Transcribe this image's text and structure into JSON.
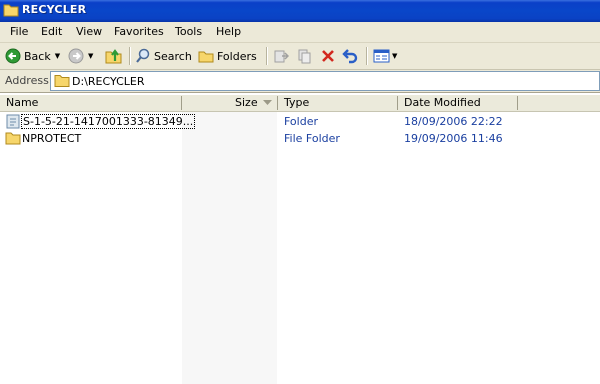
{
  "window": {
    "title": "RECYCLER"
  },
  "menu": [
    "File",
    "Edit",
    "View",
    "Favorites",
    "Tools",
    "Help"
  ],
  "toolbar": {
    "back_label": "Back",
    "search_label": "Search",
    "folders_label": "Folders"
  },
  "address": {
    "label": "Address",
    "value": "D:\\RECYCLER"
  },
  "columns": {
    "name": "Name",
    "size": "Size",
    "type": "Type",
    "date": "Date Modified"
  },
  "files": [
    {
      "name": "S-1-5-21-1417001333-81349...",
      "size": "",
      "type": "Folder",
      "date": "18/09/2006 22:22",
      "icon": "recycle-folder-icon",
      "selected": true
    },
    {
      "name": "NPROTECT",
      "size": "",
      "type": "File Folder",
      "date": "19/09/2006 11:46",
      "icon": "folder-icon",
      "selected": false
    }
  ],
  "colors": {
    "titlebar": "#0a42c4",
    "chrome": "#ece9d8",
    "detail_text": "#1a3fa0"
  }
}
